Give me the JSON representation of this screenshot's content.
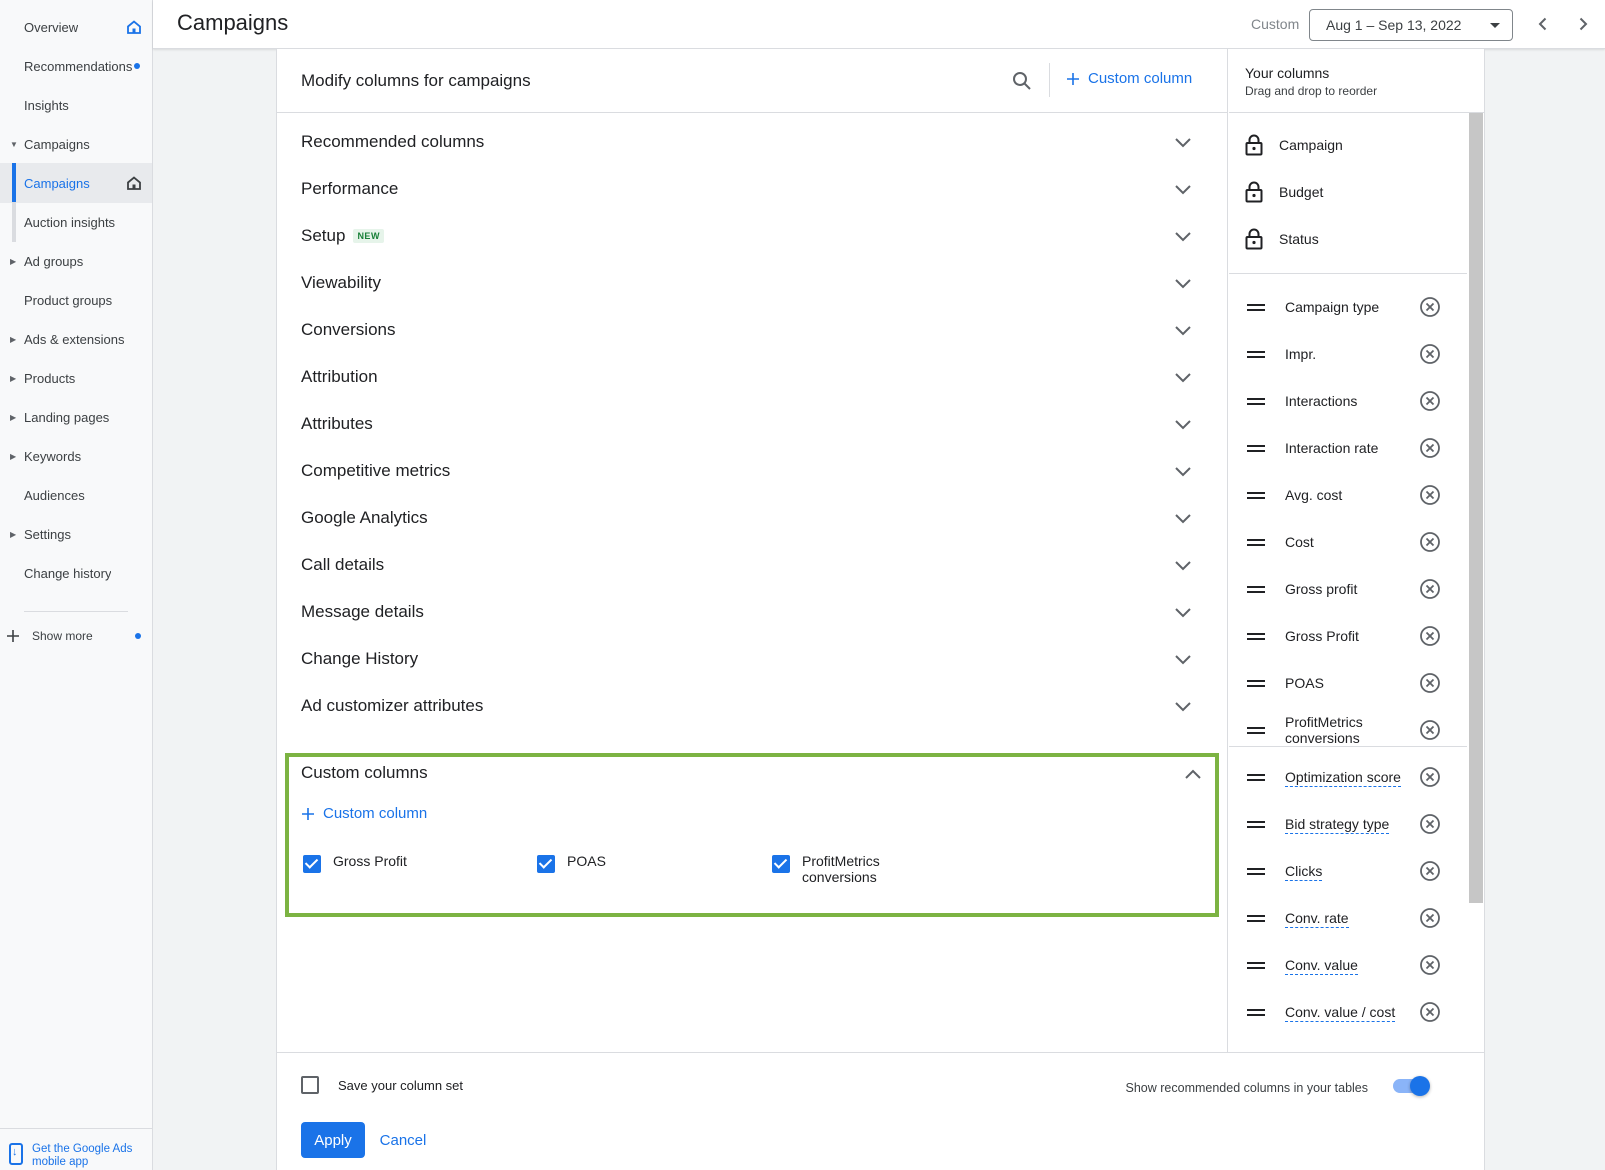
{
  "sidebar": {
    "items": [
      {
        "label": "Overview",
        "icon": "home-icon"
      },
      {
        "label": "Recommendations",
        "indicator": "blue-dot"
      },
      {
        "label": "Insights"
      },
      {
        "label": "Campaigns",
        "expanded": true
      },
      {
        "label": "Campaigns",
        "icon": "home-icon",
        "selected": true
      },
      {
        "label": "Auction insights"
      },
      {
        "label": "Ad groups"
      },
      {
        "label": "Product groups"
      },
      {
        "label": "Ads & extensions"
      },
      {
        "label": "Products"
      },
      {
        "label": "Landing pages"
      },
      {
        "label": "Keywords"
      },
      {
        "label": "Audiences"
      },
      {
        "label": "Settings"
      },
      {
        "label": "Change history"
      }
    ],
    "show_more": "Show more",
    "mobile_app": "Get the Google Ads mobile app"
  },
  "header": {
    "title": "Campaigns",
    "date_kind": "Custom",
    "date_range": "Aug 1 – Sep 13, 2022"
  },
  "modal": {
    "title": "Modify columns for campaigns",
    "custom_column_label": "Custom column",
    "categories": [
      {
        "label": "Recommended columns"
      },
      {
        "label": "Performance"
      },
      {
        "label": "Setup",
        "badge": "NEW"
      },
      {
        "label": "Viewability"
      },
      {
        "label": "Conversions"
      },
      {
        "label": "Attribution"
      },
      {
        "label": "Attributes"
      },
      {
        "label": "Competitive metrics"
      },
      {
        "label": "Google Analytics"
      },
      {
        "label": "Call details"
      },
      {
        "label": "Message details"
      },
      {
        "label": "Change History"
      },
      {
        "label": "Ad customizer attributes"
      }
    ],
    "custom_columns": {
      "title": "Custom columns",
      "add_label": "Custom column",
      "items": [
        {
          "label": "Gross Profit",
          "checked": true
        },
        {
          "label": "POAS",
          "checked": true
        },
        {
          "label": "ProfitMetrics conversions",
          "checked": true
        }
      ]
    },
    "your_columns": {
      "title": "Your columns",
      "subtitle": "Drag and drop to reorder",
      "locked": [
        "Campaign",
        "Budget",
        "Status"
      ],
      "custom": [
        "Campaign type",
        "Impr.",
        "Interactions",
        "Interaction rate",
        "Avg. cost",
        "Cost",
        "Gross profit",
        "Gross Profit",
        "POAS",
        "ProfitMetrics conversions"
      ],
      "recommended": [
        "Optimization score",
        "Bid strategy type",
        "Clicks",
        "Conv. rate",
        "Conv. value",
        "Conv. value / cost"
      ]
    },
    "footer": {
      "save_label": "Save your column set",
      "save_checked": false,
      "show_recommended_label": "Show recommended columns in your tables",
      "show_recommended_on": true,
      "apply_label": "Apply",
      "cancel_label": "Cancel"
    }
  },
  "colors": {
    "accent": "#1a73e8",
    "highlight_border": "#7cb342",
    "new_badge": "#188038"
  }
}
